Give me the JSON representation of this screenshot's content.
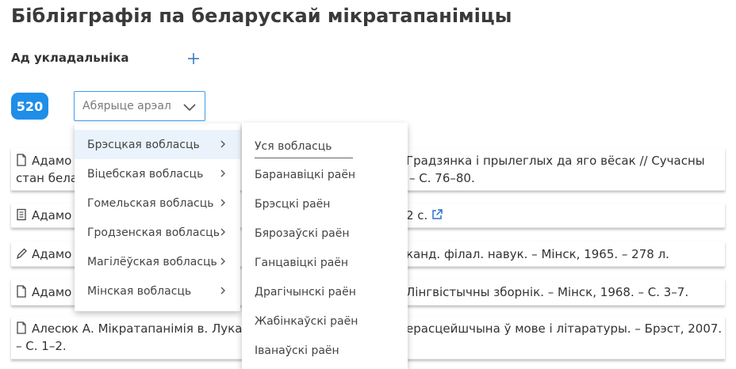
{
  "page": {
    "title": "Бібліяграфія па беларускай мікратапаніміцы",
    "compiler_label": "Ад укладальніка",
    "count": "520"
  },
  "filter": {
    "placeholder": "Абярыце арэал"
  },
  "regions": [
    {
      "label": "Брэсцкая вобласць",
      "active": true
    },
    {
      "label": "Віцебская вобласць"
    },
    {
      "label": "Гомельская вобласць"
    },
    {
      "label": "Гродзенская вобласць"
    },
    {
      "label": "Магілёўская вобласць"
    },
    {
      "label": "Мінская вобласць"
    }
  ],
  "districts": [
    {
      "label": "Уся вобласць"
    },
    {
      "label": "Баранавіцкі раён"
    },
    {
      "label": "Брэсцкі раён"
    },
    {
      "label": "Бярозаўскі раён"
    },
    {
      "label": "Ганцавіцкі раён"
    },
    {
      "label": "Драгічынскі раён"
    },
    {
      "label": "Жабінкаўскі раён"
    },
    {
      "label": "Іванаўскі раён"
    }
  ],
  "entries": [
    {
      "icon": "document-icon",
      "left_text": "Адамо",
      "right_text_1": "Градзянка і прылеглых да яго вёсак // Сучасны",
      "left_text_2": "стан бела",
      "right_text_2": "– С. 76–80."
    },
    {
      "icon": "book-icon",
      "left_text": "Адамо",
      "right_text_1": "2 с."
    },
    {
      "icon": "pencil-icon",
      "left_text": "Адамо",
      "right_text_1": "канд. філал. навук. – Мінск, 1965. – 278 л."
    },
    {
      "icon": "document-icon",
      "left_text": "Адамо",
      "right_text_1": "Лінгвістычны зборнік. – Мінск, 1968. – С. 3–7."
    },
    {
      "icon": "document-icon",
      "left_text": "Алесюк А. Мікратапанімія в. Лука",
      "right_text_1": "ерасцейшчына ў мове і літаратуры. – Брэст, 2007.",
      "left_text_2": "– С. 1–2."
    }
  ],
  "colors": {
    "accent": "#1f8ee8",
    "select_border": "#3b9cf0",
    "active_item_bg": "#eaf3fb"
  }
}
